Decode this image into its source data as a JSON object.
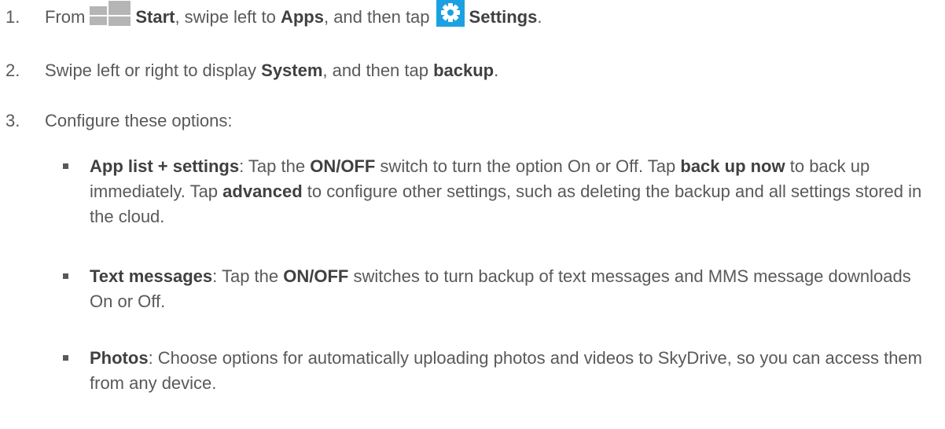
{
  "steps": [
    {
      "number": "1.",
      "parts": {
        "t1": "From",
        "icon1": "windows-start-icon",
        "b1": "Start",
        "t2": ", swipe left to ",
        "b2": "Apps",
        "t3": ", and then tap",
        "icon2": "settings-gear-icon",
        "b3": "Settings",
        "t4": "."
      }
    },
    {
      "number": "2.",
      "parts": {
        "t1": "Swipe left or right to display ",
        "b1": "System",
        "t2": ", and then tap ",
        "b2": "backup",
        "t3": "."
      }
    },
    {
      "number": "3.",
      "parts": {
        "t1": "Configure these options:"
      }
    }
  ],
  "options": [
    {
      "title": "App list + settings",
      "parts": {
        "t1": ": Tap the ",
        "b1": "ON/OFF",
        "t2": " switch to turn the option On or Off. Tap ",
        "b2": "back up now",
        "t3": " to back up immediately. Tap ",
        "b3": "advanced",
        "t4": " to configure other settings, such as deleting the backup and all settings stored in the cloud."
      }
    },
    {
      "title": "Text messages",
      "parts": {
        "t1": ": Tap the ",
        "b1": "ON/OFF",
        "t2": " switches to turn backup of text messages and MMS message downloads On or Off."
      }
    },
    {
      "title": "Photos",
      "parts": {
        "t1": ": Choose options for automatically uploading photos and videos to SkyDrive, so you can access them from any device."
      }
    }
  ],
  "colors": {
    "text": "#595959",
    "icon_gray": "#b5b5b5",
    "settings_blue": "#1ba1e2"
  }
}
